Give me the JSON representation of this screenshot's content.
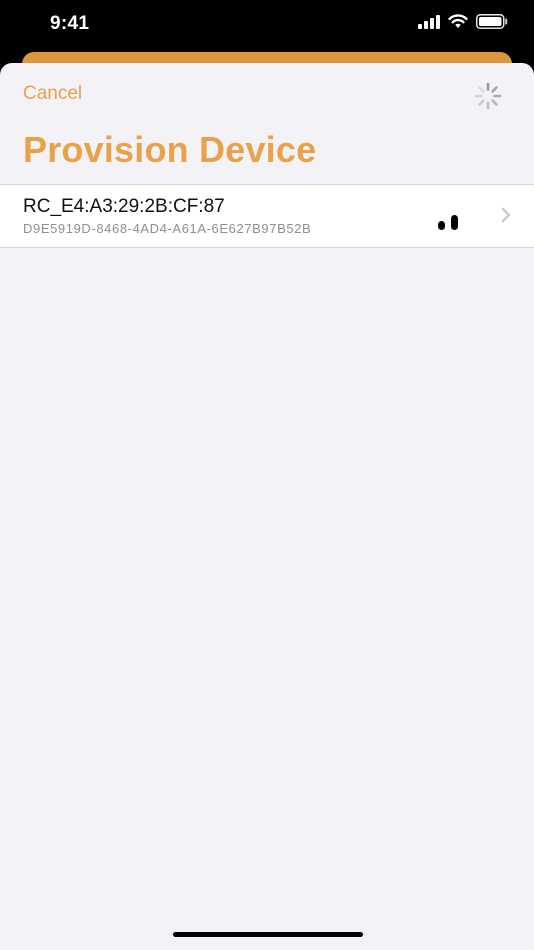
{
  "status_bar": {
    "time": "9:41",
    "icons": [
      "cellular-signal-icon",
      "wifi-icon",
      "battery-icon"
    ]
  },
  "colors": {
    "accent": "#e9a24a",
    "underlay_card": "#de953f",
    "sheet_background": "#f2f2f7",
    "row_background": "#ffffff",
    "secondary_text": "#8e8e93"
  },
  "nav": {
    "cancel_label": "Cancel",
    "activity_indicator": "spinner-icon"
  },
  "page": {
    "title": "Provision Device"
  },
  "devices": [
    {
      "name": "RC_E4:A3:29:2B:CF:87",
      "uuid": "D9E5919D-8468-4AD4-A61A-6E627B97B52B",
      "signal_icon": "signal-strength-icon",
      "signal_bars_filled": 2,
      "disclosure_icon": "chevron-right-icon"
    }
  ]
}
